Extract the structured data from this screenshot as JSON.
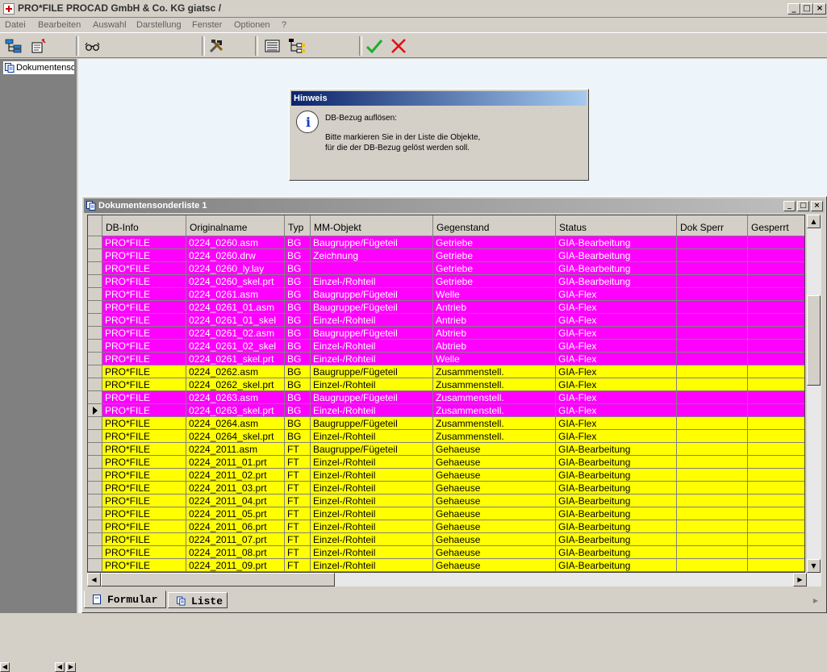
{
  "window": {
    "title": "PRO*FILE  PROCAD GmbH & Co. KG     giatsc /",
    "controls": [
      "_",
      "□",
      "×"
    ]
  },
  "menu": [
    "Datei",
    "Bearbeiten",
    "Auswahl",
    "Darstellung",
    "Fenster",
    "Optionen",
    "?"
  ],
  "toolbar": {
    "icons": [
      "tree-view-icon",
      "new-document-icon",
      "glasses-icon",
      "tools-icon",
      "list-view-icon",
      "tree-structure-icon",
      "checkmark-icon",
      "cross-icon"
    ],
    "colors": {
      "check": "#19b02a",
      "cross": "#e01010"
    }
  },
  "tree": {
    "item_label": "Dokumentensonderliste"
  },
  "dialog": {
    "title": "Hinweis",
    "heading": "DB-Bezug auflösen:",
    "line1": "Bitte markieren Sie in der Liste die Objekte,",
    "line2": "für die der DB-Bezug gelöst werden soll."
  },
  "list_window": {
    "title": "Dokumentensonderliste 1",
    "columns": [
      "DB-Info",
      "Originalname",
      "Typ",
      "MM-Objekt",
      "Gegenstand",
      "Status",
      "Dok Sperr",
      "Gesperrt"
    ],
    "rows": [
      {
        "color": "magenta",
        "marker": false,
        "cells": [
          "PRO*FILE",
          "0224_0260.asm",
          "BG",
          "Baugruppe/Fügeteil",
          "Getriebe",
          "GIA-Bearbeitung",
          "",
          ""
        ]
      },
      {
        "color": "magenta",
        "marker": false,
        "cells": [
          "PRO*FILE",
          "0224_0260.drw",
          "BG",
          "Zeichnung",
          "Getriebe",
          "GIA-Bearbeitung",
          "",
          ""
        ]
      },
      {
        "color": "magenta",
        "marker": false,
        "cells": [
          "PRO*FILE",
          "0224_0260_ly.lay",
          "BG",
          "",
          "Getriebe",
          "GIA-Bearbeitung",
          "",
          ""
        ]
      },
      {
        "color": "magenta",
        "marker": false,
        "cells": [
          "PRO*FILE",
          "0224_0260_skel.prt",
          "BG",
          "Einzel-/Rohteil",
          "Getriebe",
          "GIA-Bearbeitung",
          "",
          ""
        ]
      },
      {
        "color": "magenta",
        "marker": false,
        "cells": [
          "PRO*FILE",
          "0224_0261.asm",
          "BG",
          "Baugruppe/Fügeteil",
          "Welle",
          "GIA-Flex",
          "",
          ""
        ]
      },
      {
        "color": "magenta",
        "marker": false,
        "cells": [
          "PRO*FILE",
          "0224_0261_01.asm",
          "BG",
          "Baugruppe/Fügeteil",
          "Antrieb",
          "GIA-Flex",
          "",
          ""
        ]
      },
      {
        "color": "magenta",
        "marker": false,
        "cells": [
          "PRO*FILE",
          "0224_0261_01_skel",
          "BG",
          "Einzel-/Rohteil",
          "Antrieb",
          "GIA-Flex",
          "",
          ""
        ]
      },
      {
        "color": "magenta",
        "marker": false,
        "cells": [
          "PRO*FILE",
          "0224_0261_02.asm",
          "BG",
          "Baugruppe/Fügeteil",
          "Abtrieb",
          "GIA-Flex",
          "",
          ""
        ]
      },
      {
        "color": "magenta",
        "marker": false,
        "cells": [
          "PRO*FILE",
          "0224_0261_02_skel",
          "BG",
          "Einzel-/Rohteil",
          "Abtrieb",
          "GIA-Flex",
          "",
          ""
        ]
      },
      {
        "color": "magenta",
        "marker": false,
        "cells": [
          "PRO*FILE",
          "0224_0261_skel.prt",
          "BG",
          "Einzel-/Rohteil",
          "Welle",
          "GIA-Flex",
          "",
          ""
        ]
      },
      {
        "color": "yellow",
        "marker": false,
        "cells": [
          "PRO*FILE",
          "0224_0262.asm",
          "BG",
          "Baugruppe/Fügeteil",
          "Zusammenstell.",
          "GIA-Flex",
          "",
          ""
        ]
      },
      {
        "color": "yellow",
        "marker": false,
        "cells": [
          "PRO*FILE",
          "0224_0262_skel.prt",
          "BG",
          "Einzel-/Rohteil",
          "Zusammenstell.",
          "GIA-Flex",
          "",
          ""
        ]
      },
      {
        "color": "magenta",
        "marker": false,
        "cells": [
          "PRO*FILE",
          "0224_0263.asm",
          "BG",
          "Baugruppe/Fügeteil",
          "Zusammenstell.",
          "GIA-Flex",
          "",
          ""
        ]
      },
      {
        "color": "magenta",
        "marker": true,
        "cells": [
          "PRO*FILE",
          "0224_0263_skel.prt",
          "BG",
          "Einzel-/Rohteil",
          "Zusammenstell.",
          "GIA-Flex",
          "",
          ""
        ]
      },
      {
        "color": "yellow",
        "marker": false,
        "cells": [
          "PRO*FILE",
          "0224_0264.asm",
          "BG",
          "Baugruppe/Fügeteil",
          "Zusammenstell.",
          "GIA-Flex",
          "",
          ""
        ]
      },
      {
        "color": "yellow",
        "marker": false,
        "cells": [
          "PRO*FILE",
          "0224_0264_skel.prt",
          "BG",
          "Einzel-/Rohteil",
          "Zusammenstell.",
          "GIA-Flex",
          "",
          ""
        ]
      },
      {
        "color": "yellow",
        "marker": false,
        "cells": [
          "PRO*FILE",
          "0224_2011.asm",
          "FT",
          "Baugruppe/Fügeteil",
          "Gehaeuse",
          "GIA-Bearbeitung",
          "",
          ""
        ]
      },
      {
        "color": "yellow",
        "marker": false,
        "cells": [
          "PRO*FILE",
          "0224_2011_01.prt",
          "FT",
          "Einzel-/Rohteil",
          "Gehaeuse",
          "GIA-Bearbeitung",
          "",
          ""
        ]
      },
      {
        "color": "yellow",
        "marker": false,
        "cells": [
          "PRO*FILE",
          "0224_2011_02.prt",
          "FT",
          "Einzel-/Rohteil",
          "Gehaeuse",
          "GIA-Bearbeitung",
          "",
          ""
        ]
      },
      {
        "color": "yellow",
        "marker": false,
        "cells": [
          "PRO*FILE",
          "0224_2011_03.prt",
          "FT",
          "Einzel-/Rohteil",
          "Gehaeuse",
          "GIA-Bearbeitung",
          "",
          ""
        ]
      },
      {
        "color": "yellow",
        "marker": false,
        "cells": [
          "PRO*FILE",
          "0224_2011_04.prt",
          "FT",
          "Einzel-/Rohteil",
          "Gehaeuse",
          "GIA-Bearbeitung",
          "",
          ""
        ]
      },
      {
        "color": "yellow",
        "marker": false,
        "cells": [
          "PRO*FILE",
          "0224_2011_05.prt",
          "FT",
          "Einzel-/Rohteil",
          "Gehaeuse",
          "GIA-Bearbeitung",
          "",
          ""
        ]
      },
      {
        "color": "yellow",
        "marker": false,
        "cells": [
          "PRO*FILE",
          "0224_2011_06.prt",
          "FT",
          "Einzel-/Rohteil",
          "Gehaeuse",
          "GIA-Bearbeitung",
          "",
          ""
        ]
      },
      {
        "color": "yellow",
        "marker": false,
        "cells": [
          "PRO*FILE",
          "0224_2011_07.prt",
          "FT",
          "Einzel-/Rohteil",
          "Gehaeuse",
          "GIA-Bearbeitung",
          "",
          ""
        ]
      },
      {
        "color": "yellow",
        "marker": false,
        "cells": [
          "PRO*FILE",
          "0224_2011_08.prt",
          "FT",
          "Einzel-/Rohteil",
          "Gehaeuse",
          "GIA-Bearbeitung",
          "",
          ""
        ]
      },
      {
        "color": "yellow",
        "marker": false,
        "cells": [
          "PRO*FILE",
          "0224_2011_09.prt",
          "FT",
          "Einzel-/Rohteil",
          "Gehaeuse",
          "GIA-Bearbeitung",
          "",
          ""
        ]
      }
    ],
    "row_colors": {
      "magenta": {
        "bg": "#ff00ff",
        "fg": "#ffffff"
      },
      "yellow": {
        "bg": "#ffff00",
        "fg": "#000000"
      }
    }
  },
  "tabs": [
    {
      "label": "Formular",
      "icon": "form-icon",
      "active": true
    },
    {
      "label": "Liste",
      "icon": "list-icon",
      "active": false
    }
  ]
}
